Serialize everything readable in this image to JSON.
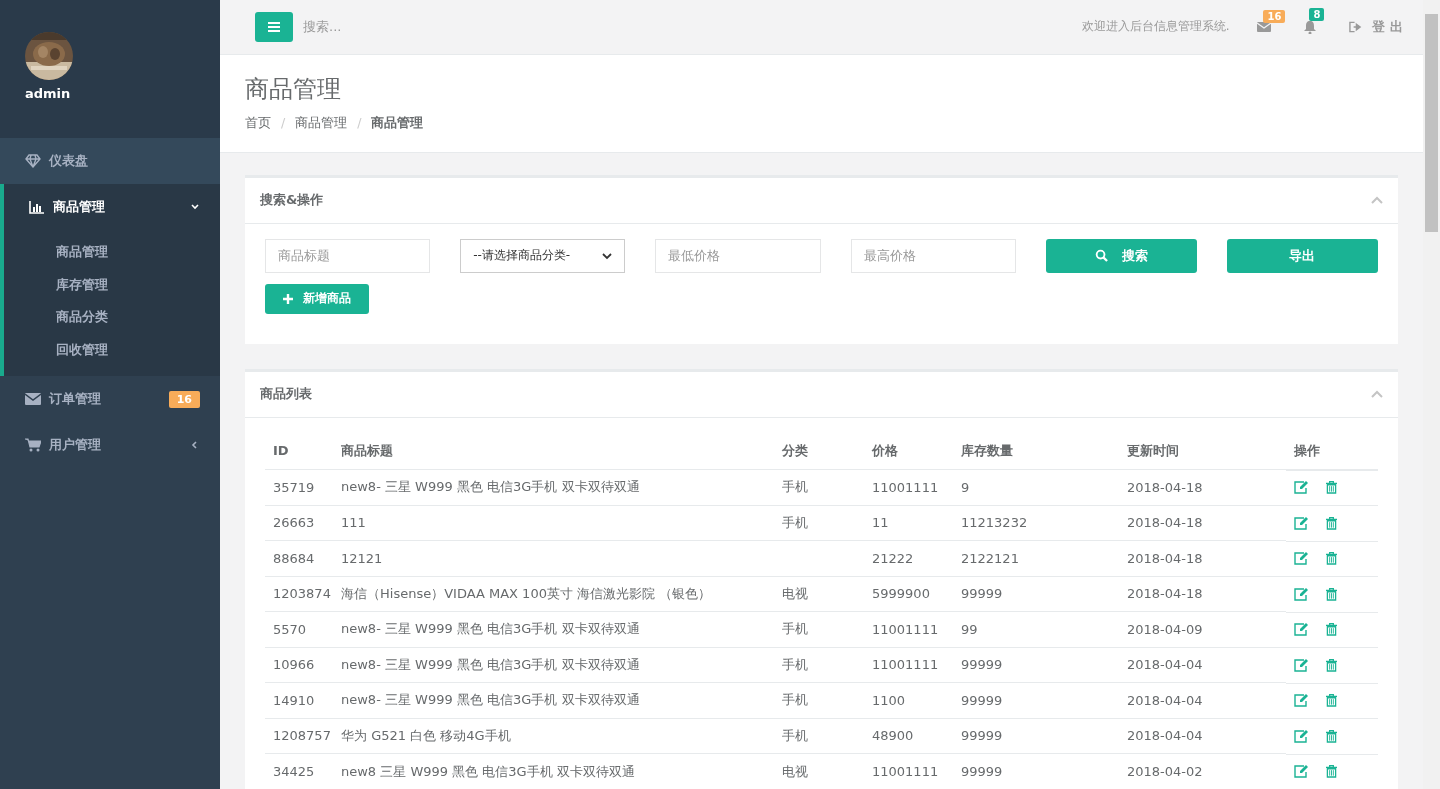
{
  "sidebar": {
    "user": {
      "name": "admin"
    },
    "items": [
      {
        "label": "仪表盘",
        "kind": "link",
        "selected": false
      },
      {
        "label": "商品管理",
        "kind": "menu",
        "selected": true,
        "expanded": true,
        "children": [
          {
            "label": "商品管理"
          },
          {
            "label": "库存管理"
          },
          {
            "label": "商品分类"
          },
          {
            "label": "回收管理"
          }
        ]
      },
      {
        "label": "订单管理",
        "kind": "link",
        "selected": false,
        "badge": "16"
      },
      {
        "label": "用户管理",
        "kind": "menu",
        "selected": false,
        "expanded": false
      }
    ]
  },
  "topbar": {
    "search": {
      "placeholder": "搜索..."
    },
    "welcome": "欢迎进入后台信息管理系统.",
    "mail_count": "16",
    "alert_count": "8",
    "logout": "登 出"
  },
  "page_header": {
    "title": "商品管理",
    "breadcrumb_separator": "/",
    "breadcrumb": [
      {
        "label": "首页",
        "selected": false
      },
      {
        "label": "商品管理",
        "selected": false
      },
      {
        "label": "商品管理",
        "selected": true
      }
    ]
  },
  "search_panel": {
    "title": "搜索&操作",
    "title_field": {
      "placeholder": "商品标题"
    },
    "category_select": {
      "value": "--请选择商品分类-"
    },
    "min_price": {
      "placeholder": "最低价格"
    },
    "max_price": {
      "placeholder": "最高价格"
    },
    "search_button": "搜索",
    "export_button": "导出",
    "add_button": "新增商品"
  },
  "product_list": {
    "title": "商品列表",
    "columns": [
      "ID",
      "商品标题",
      "分类",
      "价格",
      "库存数量",
      "更新时间",
      "操作"
    ],
    "rows": [
      [
        "35719",
        "new8- 三星 W999 黑色 电信3G手机 双卡双待双通",
        "手机",
        "11001111",
        "9",
        "2018-04-18"
      ],
      [
        "26663",
        "111",
        "手机",
        "11",
        "11213232",
        "2018-04-18"
      ],
      [
        "88684",
        "12121",
        "",
        "21222",
        "2122121",
        "2018-04-18"
      ],
      [
        "1203874",
        "海信（Hisense）VIDAA MAX 100英寸 海信激光影院 （银色）",
        "电视",
        "5999900",
        "99999",
        "2018-04-18"
      ],
      [
        "5570",
        "new8- 三星 W999 黑色 电信3G手机 双卡双待双通",
        "手机",
        "11001111",
        "99",
        "2018-04-09"
      ],
      [
        "10966",
        "new8- 三星 W999 黑色 电信3G手机 双卡双待双通",
        "手机",
        "11001111",
        "99999",
        "2018-04-04"
      ],
      [
        "14910",
        "new8- 三星 W999 黑色 电信3G手机 双卡双待双通",
        "手机",
        "1100",
        "99999",
        "2018-04-04"
      ],
      [
        "1208757",
        "华为 G521 白色 移动4G手机",
        "手机",
        "48900",
        "99999",
        "2018-04-04"
      ],
      [
        "34425",
        "new8 三星 W999 黑色 电信3G手机 双卡双待双通",
        "电视",
        "11001111",
        "99999",
        "2018-04-02"
      ]
    ]
  }
}
